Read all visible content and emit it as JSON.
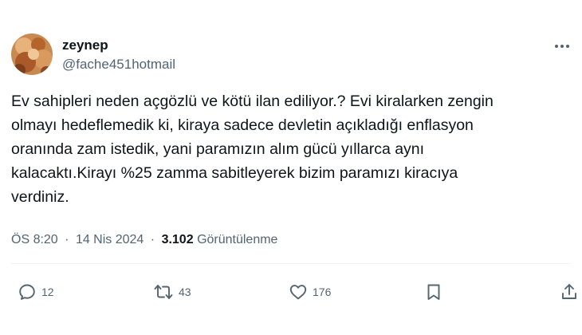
{
  "user": {
    "display_name": "zeynep",
    "handle": "@fache451hotmail"
  },
  "tweet": {
    "lines": [
      "Ev sahipleri neden açgözlü ve kötü ilan ediliyor.? Evi kiralarken zengin",
      "olmayı hedeflemedik ki, kiraya sadece devletin açıkladığı enflasyon",
      "oranında zam istedik, yani paramızın alım gücü yıllarca aynı",
      "kalacaktı.Kirayı %25 zamma sabitleyerek  bizim paramızı kiracıya",
      "verdiniz."
    ]
  },
  "meta": {
    "time": "ÖS 8:20",
    "separator": "·",
    "date": "14 Nis 2024",
    "views_count": "3.102",
    "views_label": "Görüntülenme"
  },
  "actions": {
    "replies": "12",
    "retweets": "43",
    "likes": "176"
  },
  "icons": {
    "more": "more-horizontal-icon",
    "reply": "reply-icon",
    "retweet": "retweet-icon",
    "like": "heart-icon",
    "bookmark": "bookmark-icon",
    "share": "share-icon"
  },
  "colors": {
    "text": "#0f1419",
    "secondary": "#536471",
    "divider": "#eff3f4"
  }
}
